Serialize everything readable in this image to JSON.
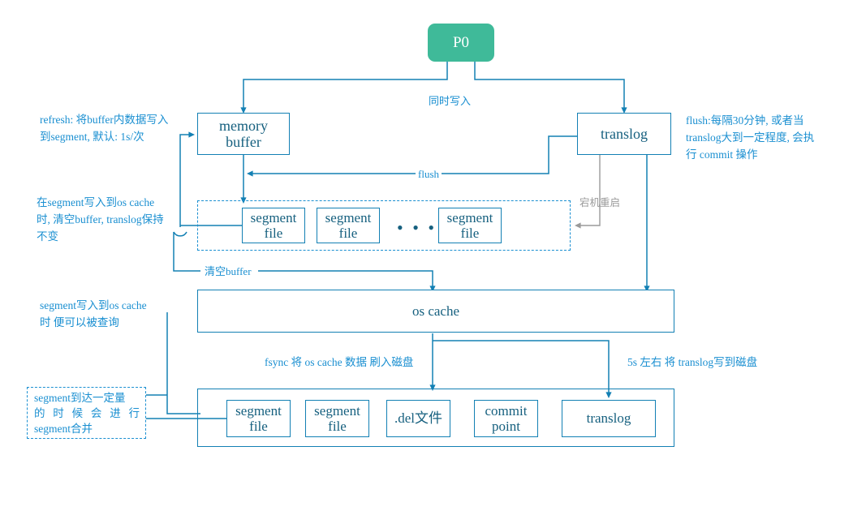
{
  "diagram": {
    "title": "Elasticsearch 写入流程 (memory buffer / translog / os cache / 磁盘)",
    "colors": {
      "accent_blue": "#1380b4",
      "label_blue": "#1a8fd1",
      "node_text": "#16607f",
      "p0_green": "#3fba99",
      "gray": "#9a9a9a",
      "background": "#ffffff"
    }
  },
  "nodes": {
    "p0": "P0",
    "memory_buffer": "memory\nbuffer",
    "translog_top": "translog",
    "segment_file_1": "segment\nfile",
    "segment_file_2": "segment\nfile",
    "segment_file_3": "segment\nfile",
    "segment_ellipsis": "• • •",
    "os_cache": "os cache",
    "disk_segment_file_1": "segment\nfile",
    "disk_segment_file_2": "segment\nfile",
    "disk_del_file": ".del文件",
    "disk_commit_point": "commit\npoint",
    "disk_translog": "translog"
  },
  "edge_labels": {
    "write_both": "同时写入",
    "flush": "flush",
    "clear_buffer": "清空buffer",
    "crash_restart": "宕机重启",
    "fsync_to_disk": "fsync 将 os cache 数据 刷入磁盘",
    "translog_to_disk": "5s 左右 将 translog写到磁盘"
  },
  "annotations": {
    "refresh": "refresh: 将buffer内数据写入\n到segment, 默认: 1s/次",
    "flush_detail": "flush:每隔30分钟, 或者当\ntranslog大到一定程度, 会执\n行 commit 操作",
    "clear_buffer_note": "在segment写入到os cache\n时, 清空buffer, translog保持\n不变",
    "searchable_note": "segment写入到os cache\n时 便可以被查询",
    "merge_note_line1": "segment到达一定量",
    "merge_note_line2": "的 时 候 会 进 行",
    "merge_note_line3": "segment合并"
  }
}
